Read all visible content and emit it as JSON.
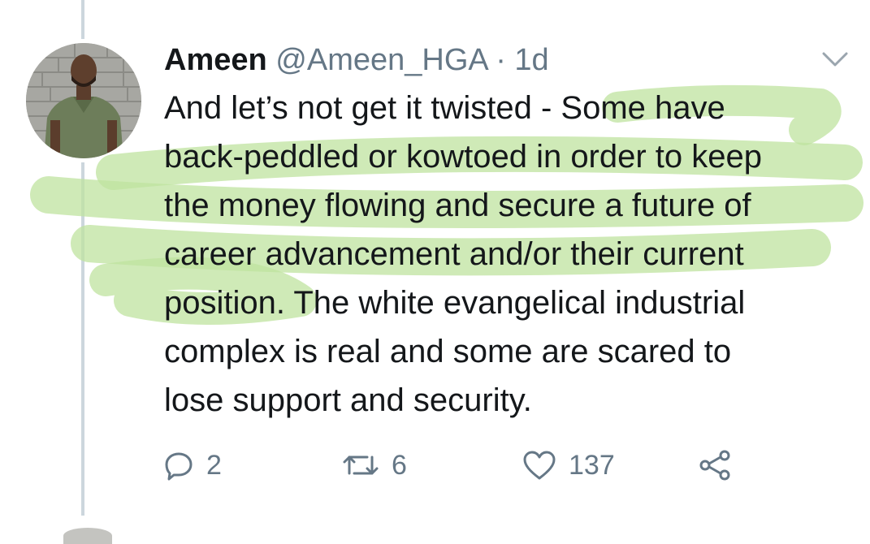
{
  "tweet": {
    "author_name": "Ameen",
    "handle": "@Ameen_HGA",
    "separator": "·",
    "time": "1d",
    "text_lines": [
      "And let’s not get it twisted - Some have",
      "back-peddled or kowtoed in order to keep",
      "the money flowing and secure a future of",
      "career advancement and/or their current",
      "position. The white evangelical industrial",
      "complex is real and some are scared to",
      "lose support and security."
    ],
    "replies": "2",
    "retweets": "6",
    "likes": "137"
  },
  "icons": {
    "menu": "chevron-down-icon",
    "reply": "reply-icon",
    "retweet": "retweet-icon",
    "like": "heart-icon",
    "share": "share-icon"
  },
  "colors": {
    "text": "#14171a",
    "secondary": "#657786",
    "thread_line": "#ccd6dd",
    "highlight": "#c5e6a6"
  }
}
